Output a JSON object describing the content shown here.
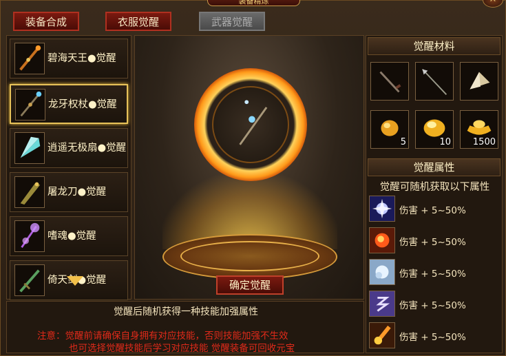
{
  "window": {
    "title": "装备精炼",
    "close_icon": "close-icon"
  },
  "tabs": [
    {
      "label": "装备合成",
      "active": true
    },
    {
      "label": "衣服觉醒",
      "active": true
    },
    {
      "label": "武器觉醒",
      "active": false
    }
  ],
  "weapons": [
    {
      "label": "碧海天王●觉醒",
      "icon": "staff-icon",
      "selected": false
    },
    {
      "label": "龙牙权杖●觉醒",
      "icon": "scepter-icon",
      "selected": true
    },
    {
      "label": "逍遥无极扇●觉醒",
      "icon": "fan-icon",
      "selected": false
    },
    {
      "label": "屠龙刀●觉醒",
      "icon": "blade-icon",
      "selected": false
    },
    {
      "label": "嗜魂●觉醒",
      "icon": "soul-staff-icon",
      "selected": false
    },
    {
      "label": "倚天剑●觉醒",
      "icon": "sword-icon",
      "selected": false
    }
  ],
  "preview": {
    "icon": "scepter-icon"
  },
  "confirm_label": "确定觉醒",
  "materials": {
    "title": "觉醒材料",
    "items": [
      {
        "icon": "dagger-icon",
        "count": ""
      },
      {
        "icon": "spear-icon",
        "count": ""
      },
      {
        "icon": "fan-icon",
        "count": ""
      },
      {
        "icon": "gold-ore-icon",
        "count": "5"
      },
      {
        "icon": "gold-nugget-icon",
        "count": "10"
      },
      {
        "icon": "gold-ingot-icon",
        "count": "1500"
      }
    ]
  },
  "attributes": {
    "title": "觉醒属性",
    "subtitle": "觉醒可随机获取以下属性",
    "items": [
      {
        "icon": "lightning-skill-icon",
        "text": "伤害 + 5~50%"
      },
      {
        "icon": "fire-skill-icon",
        "text": "伤害 + 5~50%"
      },
      {
        "icon": "ice-skill-icon",
        "text": "伤害 + 5~50%"
      },
      {
        "icon": "rune-skill-icon",
        "text": "伤害 + 5~50%"
      },
      {
        "icon": "meteor-skill-icon",
        "text": "伤害 + 5~50%"
      }
    ]
  },
  "bottom": {
    "info": "觉醒后随机获得一种技能加强属性",
    "note_line1": "注意：觉醒前请确保自身拥有对应技能，否则技能加强不生效",
    "note_line2": "也可选择觉醒技能后学习对应技能 觉醒装备可回收元宝"
  },
  "colors": {
    "accent": "#e8c35a",
    "warning": "#e02a1a",
    "tab_red": "#b03020"
  }
}
